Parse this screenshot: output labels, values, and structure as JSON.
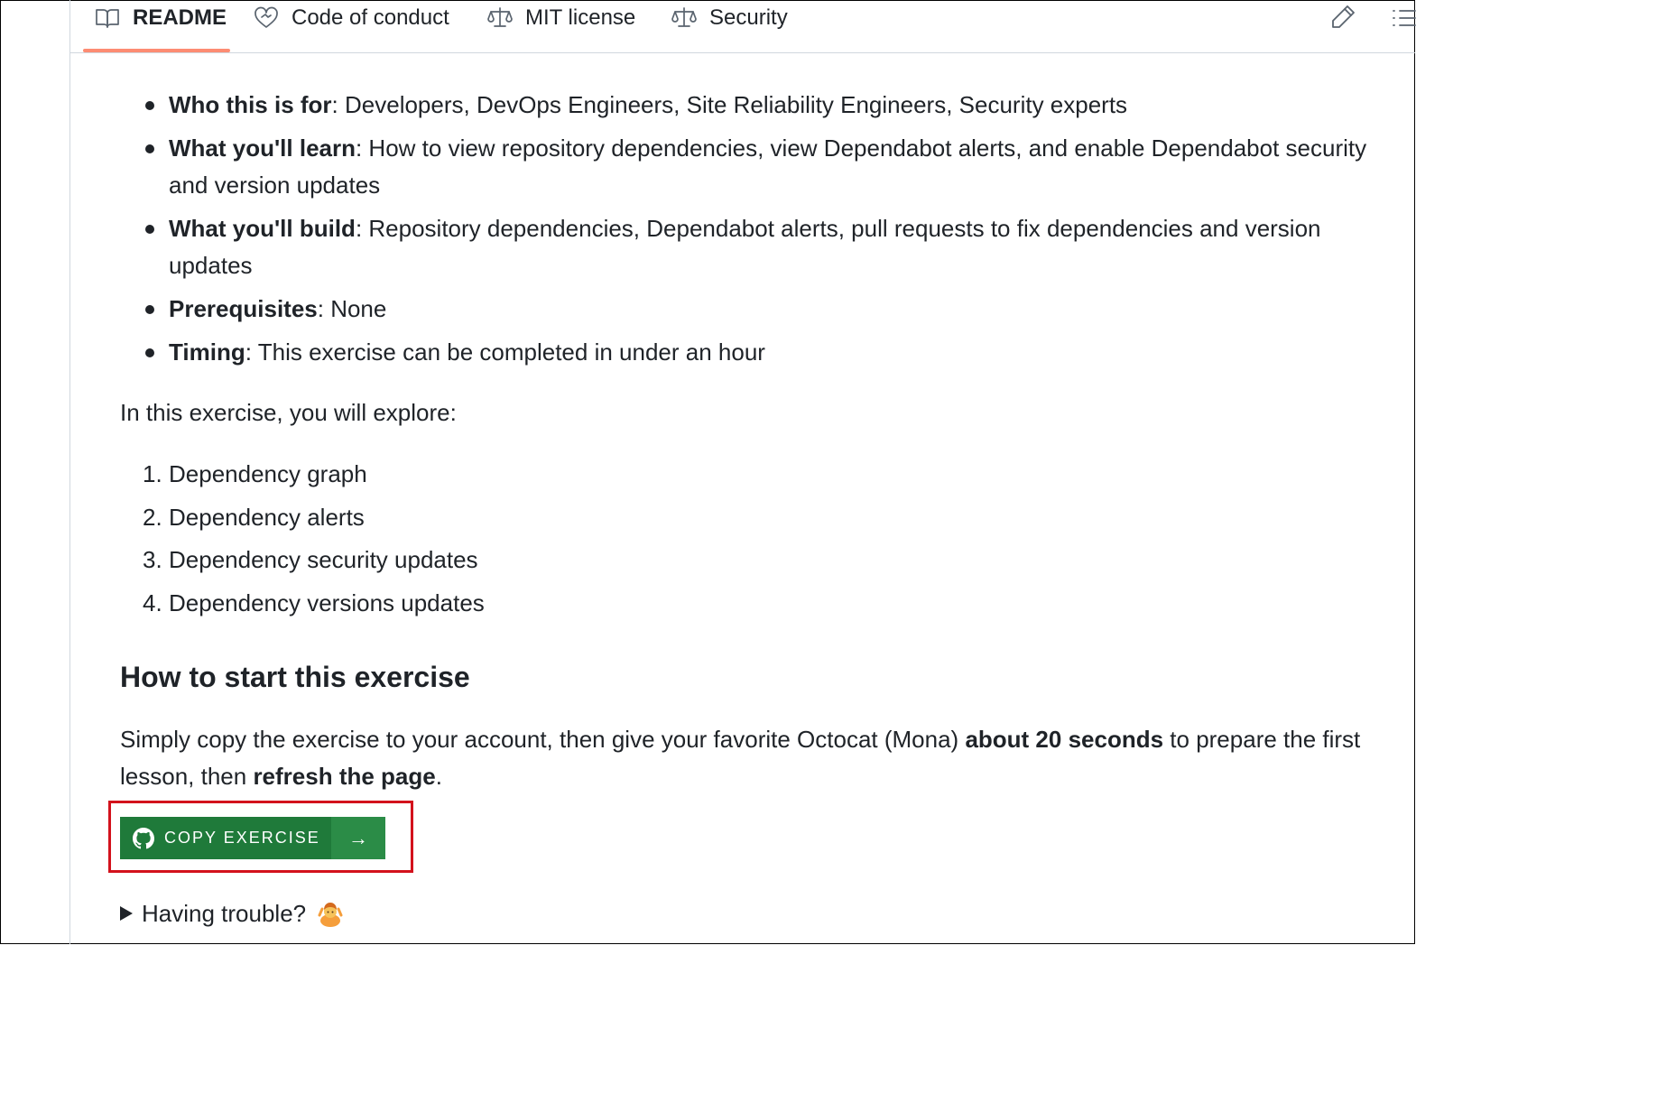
{
  "tabs": [
    {
      "label": "README",
      "icon": "book-icon",
      "active": true
    },
    {
      "label": "Code of conduct",
      "icon": "code-of-conduct-icon",
      "active": false
    },
    {
      "label": "MIT license",
      "icon": "law-icon",
      "active": false
    },
    {
      "label": "Security",
      "icon": "law-icon",
      "active": false
    }
  ],
  "toolbar": {
    "edit_icon": "pencil-icon",
    "outline_icon": "list-icon"
  },
  "overview": [
    {
      "term": "Who this is for",
      "text": ": Developers, DevOps Engineers, Site Reliability Engineers, Security experts"
    },
    {
      "term": "What you'll learn",
      "text": ": How to view repository dependencies, view Dependabot alerts, and enable Dependabot security and version updates"
    },
    {
      "term": "What you'll build",
      "text": ": Repository dependencies, Dependabot alerts, pull requests to fix dependencies and version updates"
    },
    {
      "term": "Prerequisites",
      "text": ": None"
    },
    {
      "term": "Timing",
      "text": ": This exercise can be completed in under an hour"
    }
  ],
  "intro": "In this exercise, you will explore:",
  "topics": [
    {
      "num": "1.",
      "text": "Dependency graph"
    },
    {
      "num": "2.",
      "text": "Dependency alerts"
    },
    {
      "num": "3.",
      "text": "Dependency security updates"
    },
    {
      "num": "4.",
      "text": "Dependency versions updates"
    }
  ],
  "start_section": {
    "heading": "How to start this exercise",
    "p1": "Simply copy the exercise to your account, then give your favorite Octocat (Mona) ",
    "b1": "about 20 seconds",
    "p2": " to prepare the first lesson, then ",
    "b2": "refresh the page",
    "p3": "."
  },
  "copy_button": {
    "label": "COPY EXERCISE",
    "arrow": "→",
    "icon": "github-mark-icon",
    "highlight_color": "#d3121c"
  },
  "trouble": {
    "label": "Having trouble?",
    "icon": "shrug-emoji"
  },
  "colors": {
    "button_green": "#1f7a3a",
    "tab_underline": "#fd8c73"
  }
}
